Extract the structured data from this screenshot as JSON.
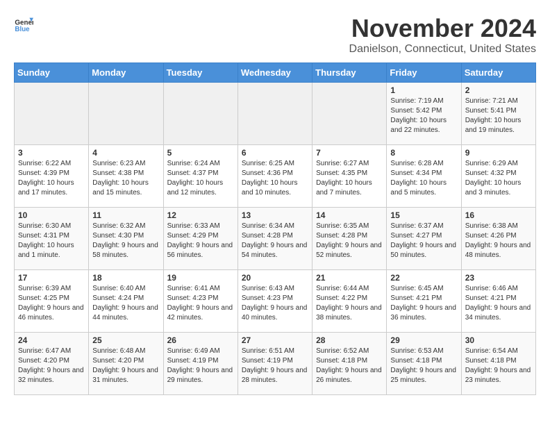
{
  "header": {
    "logo_general": "General",
    "logo_blue": "Blue",
    "title": "November 2024",
    "subtitle": "Danielson, Connecticut, United States"
  },
  "days_of_week": [
    "Sunday",
    "Monday",
    "Tuesday",
    "Wednesday",
    "Thursday",
    "Friday",
    "Saturday"
  ],
  "weeks": [
    [
      {
        "day": "",
        "info": ""
      },
      {
        "day": "",
        "info": ""
      },
      {
        "day": "",
        "info": ""
      },
      {
        "day": "",
        "info": ""
      },
      {
        "day": "",
        "info": ""
      },
      {
        "day": "1",
        "info": "Sunrise: 7:19 AM\nSunset: 5:42 PM\nDaylight: 10 hours and 22 minutes."
      },
      {
        "day": "2",
        "info": "Sunrise: 7:21 AM\nSunset: 5:41 PM\nDaylight: 10 hours and 19 minutes."
      }
    ],
    [
      {
        "day": "3",
        "info": "Sunrise: 6:22 AM\nSunset: 4:39 PM\nDaylight: 10 hours and 17 minutes."
      },
      {
        "day": "4",
        "info": "Sunrise: 6:23 AM\nSunset: 4:38 PM\nDaylight: 10 hours and 15 minutes."
      },
      {
        "day": "5",
        "info": "Sunrise: 6:24 AM\nSunset: 4:37 PM\nDaylight: 10 hours and 12 minutes."
      },
      {
        "day": "6",
        "info": "Sunrise: 6:25 AM\nSunset: 4:36 PM\nDaylight: 10 hours and 10 minutes."
      },
      {
        "day": "7",
        "info": "Sunrise: 6:27 AM\nSunset: 4:35 PM\nDaylight: 10 hours and 7 minutes."
      },
      {
        "day": "8",
        "info": "Sunrise: 6:28 AM\nSunset: 4:34 PM\nDaylight: 10 hours and 5 minutes."
      },
      {
        "day": "9",
        "info": "Sunrise: 6:29 AM\nSunset: 4:32 PM\nDaylight: 10 hours and 3 minutes."
      }
    ],
    [
      {
        "day": "10",
        "info": "Sunrise: 6:30 AM\nSunset: 4:31 PM\nDaylight: 10 hours and 1 minute."
      },
      {
        "day": "11",
        "info": "Sunrise: 6:32 AM\nSunset: 4:30 PM\nDaylight: 9 hours and 58 minutes."
      },
      {
        "day": "12",
        "info": "Sunrise: 6:33 AM\nSunset: 4:29 PM\nDaylight: 9 hours and 56 minutes."
      },
      {
        "day": "13",
        "info": "Sunrise: 6:34 AM\nSunset: 4:28 PM\nDaylight: 9 hours and 54 minutes."
      },
      {
        "day": "14",
        "info": "Sunrise: 6:35 AM\nSunset: 4:28 PM\nDaylight: 9 hours and 52 minutes."
      },
      {
        "day": "15",
        "info": "Sunrise: 6:37 AM\nSunset: 4:27 PM\nDaylight: 9 hours and 50 minutes."
      },
      {
        "day": "16",
        "info": "Sunrise: 6:38 AM\nSunset: 4:26 PM\nDaylight: 9 hours and 48 minutes."
      }
    ],
    [
      {
        "day": "17",
        "info": "Sunrise: 6:39 AM\nSunset: 4:25 PM\nDaylight: 9 hours and 46 minutes."
      },
      {
        "day": "18",
        "info": "Sunrise: 6:40 AM\nSunset: 4:24 PM\nDaylight: 9 hours and 44 minutes."
      },
      {
        "day": "19",
        "info": "Sunrise: 6:41 AM\nSunset: 4:23 PM\nDaylight: 9 hours and 42 minutes."
      },
      {
        "day": "20",
        "info": "Sunrise: 6:43 AM\nSunset: 4:23 PM\nDaylight: 9 hours and 40 minutes."
      },
      {
        "day": "21",
        "info": "Sunrise: 6:44 AM\nSunset: 4:22 PM\nDaylight: 9 hours and 38 minutes."
      },
      {
        "day": "22",
        "info": "Sunrise: 6:45 AM\nSunset: 4:21 PM\nDaylight: 9 hours and 36 minutes."
      },
      {
        "day": "23",
        "info": "Sunrise: 6:46 AM\nSunset: 4:21 PM\nDaylight: 9 hours and 34 minutes."
      }
    ],
    [
      {
        "day": "24",
        "info": "Sunrise: 6:47 AM\nSunset: 4:20 PM\nDaylight: 9 hours and 32 minutes."
      },
      {
        "day": "25",
        "info": "Sunrise: 6:48 AM\nSunset: 4:20 PM\nDaylight: 9 hours and 31 minutes."
      },
      {
        "day": "26",
        "info": "Sunrise: 6:49 AM\nSunset: 4:19 PM\nDaylight: 9 hours and 29 minutes."
      },
      {
        "day": "27",
        "info": "Sunrise: 6:51 AM\nSunset: 4:19 PM\nDaylight: 9 hours and 28 minutes."
      },
      {
        "day": "28",
        "info": "Sunrise: 6:52 AM\nSunset: 4:18 PM\nDaylight: 9 hours and 26 minutes."
      },
      {
        "day": "29",
        "info": "Sunrise: 6:53 AM\nSunset: 4:18 PM\nDaylight: 9 hours and 25 minutes."
      },
      {
        "day": "30",
        "info": "Sunrise: 6:54 AM\nSunset: 4:18 PM\nDaylight: 9 hours and 23 minutes."
      }
    ]
  ]
}
